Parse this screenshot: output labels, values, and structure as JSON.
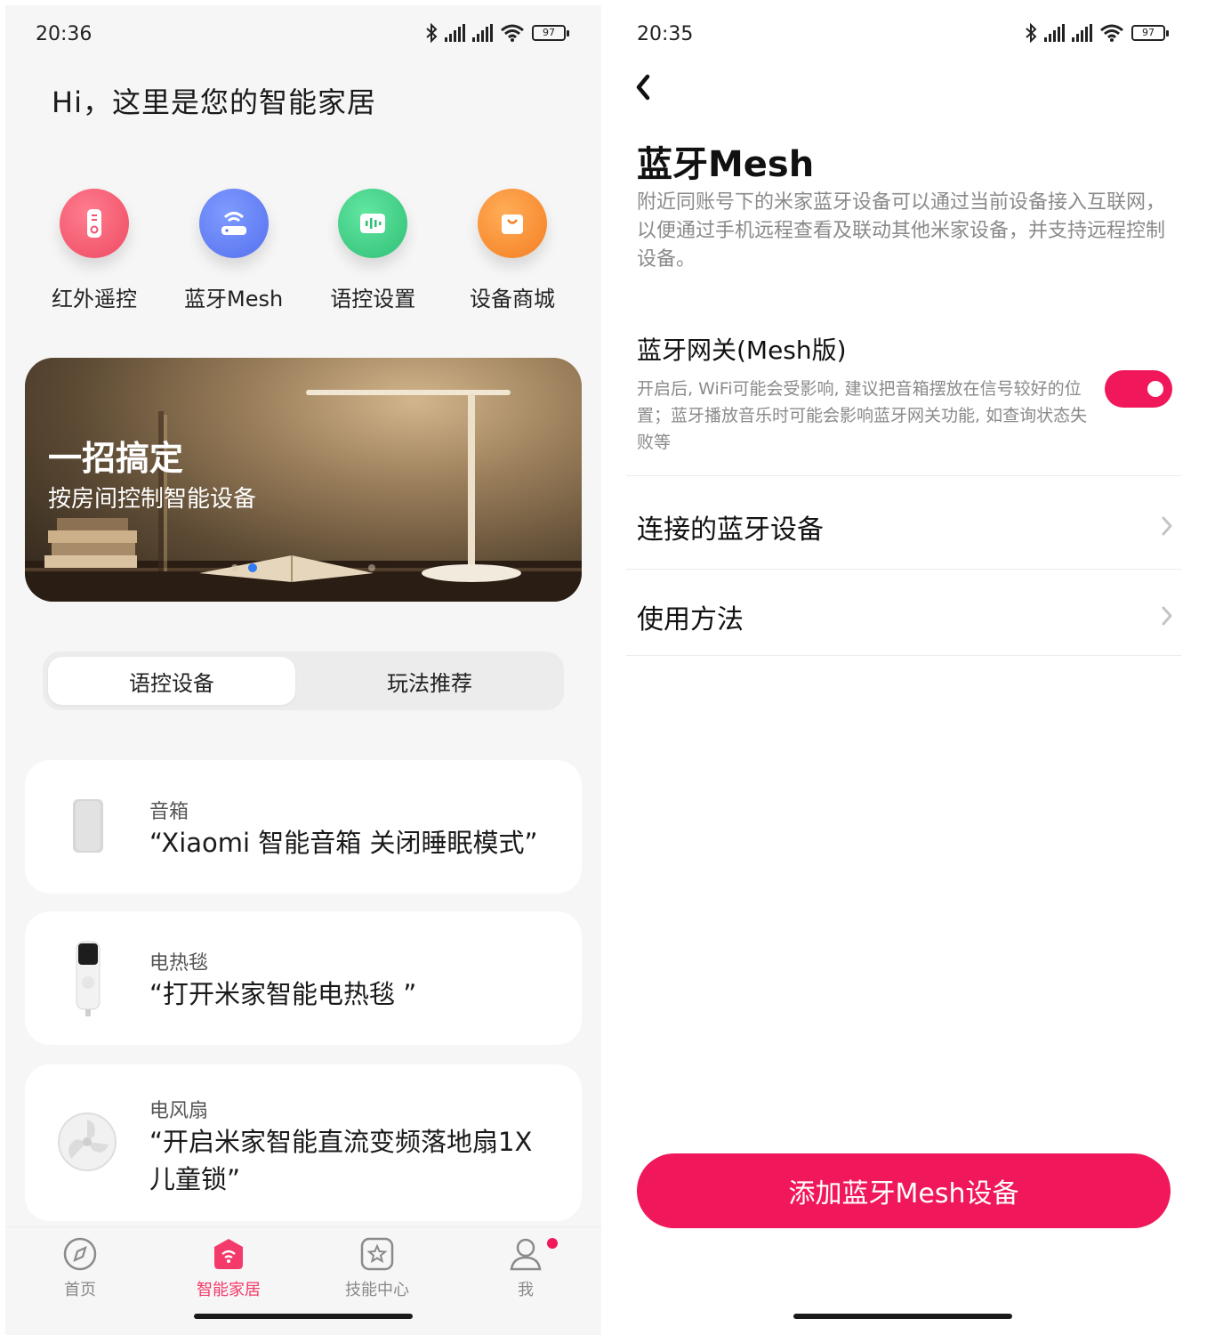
{
  "left": {
    "status": {
      "time": "20:36",
      "battery": "97"
    },
    "greeting": "Hi，这里是您的智能家居",
    "quick_actions": [
      {
        "label": "红外遥控",
        "icon": "remote-icon",
        "color": "#f0566f"
      },
      {
        "label": "蓝牙Mesh",
        "icon": "router-icon",
        "color": "#5b7cf4"
      },
      {
        "label": "语控设置",
        "icon": "voice-icon",
        "color": "#3ecf86"
      },
      {
        "label": "设备商城",
        "icon": "shopping-bag-icon",
        "color": "#f68a2b"
      }
    ],
    "banner": {
      "title": "一招搞定",
      "subtitle": "按房间控制智能设备",
      "active_dot": 1,
      "dot_count": 3
    },
    "segments": {
      "active": "语控设备",
      "inactive": "玩法推荐"
    },
    "cards": [
      {
        "category": "音箱",
        "command": "“Xiaomi 智能音箱   关闭睡眠模式”",
        "icon": "speaker-icon"
      },
      {
        "category": "电热毯",
        "command": "“打开米家智能电热毯   ”",
        "icon": "heated-blanket-controller-icon"
      },
      {
        "category": "电风扇",
        "command": "“开启米家智能直流变频落地扇1X 儿童锁”",
        "icon": "fan-icon"
      }
    ],
    "tabs": [
      {
        "label": "首页",
        "icon": "compass-icon"
      },
      {
        "label": "智能家居",
        "icon": "smart-home-icon",
        "active": true
      },
      {
        "label": "技能中心",
        "icon": "skill-center-icon"
      },
      {
        "label": "我",
        "icon": "user-icon",
        "badge": true
      }
    ],
    "accent_color": "#f33a6a"
  },
  "right": {
    "status": {
      "time": "20:35",
      "battery": "97"
    },
    "title": "蓝牙Mesh",
    "description": "附近同账号下的米家蓝牙设备可以通过当前设备接入互联网，以便通过手机远程查看及联动其他米家设备，并支持远程控制设备。",
    "gateway": {
      "title": "蓝牙网关(Mesh版)",
      "description": "开启后, WiFi可能会受影响, 建议把音箱摆放在信号较好的位置；蓝牙播放音乐时可能会影响蓝牙网关功能, 如查询状态失败等",
      "enabled": true
    },
    "rows": [
      {
        "label": "连接的蓝牙设备"
      },
      {
        "label": "使用方法"
      }
    ],
    "add_button": "添加蓝牙Mesh设备",
    "accent_color": "#f0175a"
  }
}
